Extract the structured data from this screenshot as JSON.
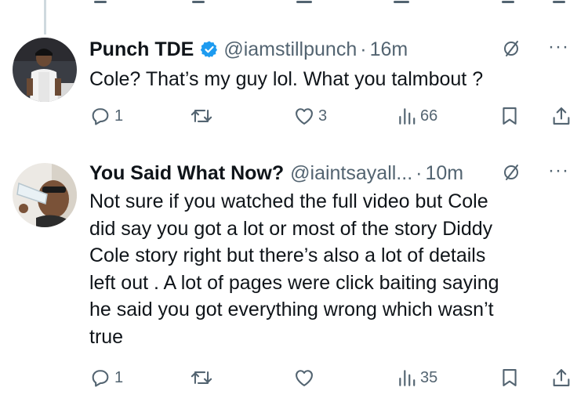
{
  "tweets": [
    {
      "name": "Punch TDE",
      "handle": "@iamstillpunch",
      "dot": "·",
      "time": "16m",
      "more": "···",
      "text": "Cole? That’s my guy lol. What you talmbout ?",
      "actions": {
        "replies": "1",
        "retweets": "",
        "likes": "3",
        "views": "66"
      },
      "icons": [
        "reply-icon",
        "retweet-icon",
        "like-icon",
        "views-icon",
        "bookmark-icon",
        "share-icon"
      ]
    },
    {
      "name": "You Said What Now?",
      "handle": "@iaintsayall...",
      "dot": "·",
      "time": "10m",
      "more": "···",
      "text_lines": [
        "Not sure if you watched the full video but Cole",
        "did say you got a lot or most of the story Diddy",
        "Cole story right but there’s also a lot of details",
        "left out . A lot of pages were click baiting saying",
        "he said you got everything wrong which wasn’t",
        "true"
      ],
      "actions": {
        "replies": "1",
        "retweets": "",
        "likes": "",
        "views": "35"
      },
      "icons": [
        "reply-icon",
        "retweet-icon",
        "like-icon",
        "views-icon",
        "bookmark-icon",
        "share-icon"
      ]
    }
  ],
  "colors": {
    "text": "#0f1419",
    "secondary": "#536471",
    "verified": "#1d9bf0",
    "thread_line": "#cfd9de"
  }
}
